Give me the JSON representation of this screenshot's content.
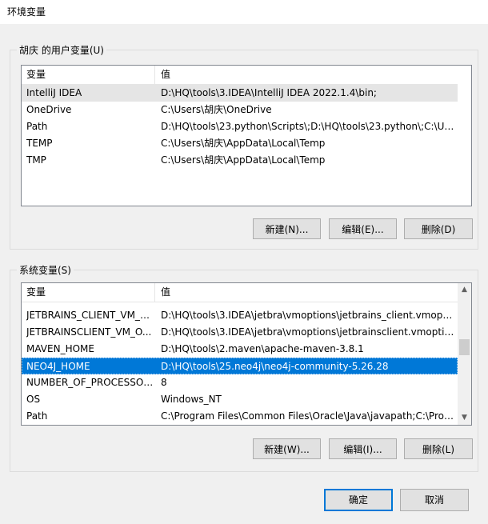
{
  "window": {
    "title": "环境变量"
  },
  "user_vars": {
    "group_label": "胡庆 的用户变量(U)",
    "columns": [
      "变量",
      "值"
    ],
    "rows": [
      {
        "name": "IntelliJ IDEA",
        "value": "D:\\HQ\\tools\\3.IDEA\\IntelliJ IDEA 2022.1.4\\bin;"
      },
      {
        "name": "OneDrive",
        "value": "C:\\Users\\胡庆\\OneDrive"
      },
      {
        "name": "Path",
        "value": "D:\\HQ\\tools\\23.python\\Scripts\\;D:\\HQ\\tools\\23.python\\;C:\\Us..."
      },
      {
        "name": "TEMP",
        "value": "C:\\Users\\胡庆\\AppData\\Local\\Temp"
      },
      {
        "name": "TMP",
        "value": "C:\\Users\\胡庆\\AppData\\Local\\Temp"
      }
    ],
    "buttons": {
      "new": "新建(N)...",
      "edit": "编辑(E)...",
      "delete": "删除(D)"
    }
  },
  "system_vars": {
    "group_label": "系统变量(S)",
    "columns": [
      "变量",
      "值"
    ],
    "rows": [
      {
        "name": "JETBRAINS_CLIENT_VM_O...",
        "value": "D:\\HQ\\tools\\3.IDEA\\jetbra\\vmoptions\\jetbrains_client.vmopti..."
      },
      {
        "name": "JETBRAINSCLIENT_VM_O...",
        "value": "D:\\HQ\\tools\\3.IDEA\\jetbra\\vmoptions\\jetbrainsclient.vmoptio..."
      },
      {
        "name": "MAVEN_HOME",
        "value": "D:\\HQ\\tools\\2.maven\\apache-maven-3.8.1"
      },
      {
        "name": "NEO4J_HOME",
        "value": "D:\\HQ\\tools\\25.neo4j\\neo4j-community-5.26.28"
      },
      {
        "name": "NUMBER_OF_PROCESSORS",
        "value": "8"
      },
      {
        "name": "OS",
        "value": "Windows_NT"
      },
      {
        "name": "Path",
        "value": "C:\\Program Files\\Common Files\\Oracle\\Java\\javapath;C:\\Prog..."
      }
    ],
    "buttons": {
      "new": "新建(W)...",
      "edit": "编辑(I)...",
      "delete": "删除(L)"
    }
  },
  "dialog_buttons": {
    "ok": "确定",
    "cancel": "取消"
  },
  "icons": {
    "scroll_up": "scroll-up-arrow-icon",
    "scroll_down": "scroll-down-arrow-icon"
  }
}
